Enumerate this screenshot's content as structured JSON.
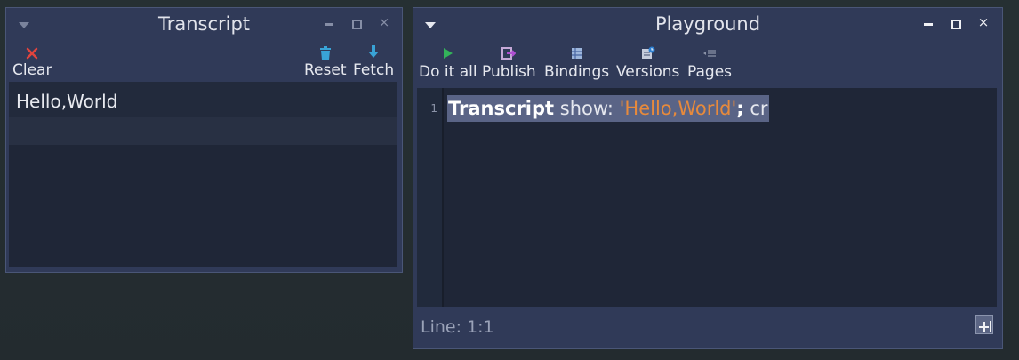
{
  "transcript": {
    "title": "Transcript",
    "toolbar": {
      "clear": "Clear",
      "reset": "Reset",
      "fetch": "Fetch"
    },
    "output": [
      "Hello,World"
    ],
    "icons": {
      "clear": "close-x-icon",
      "reset": "trash-icon",
      "fetch": "download-arrow-icon"
    },
    "colors": {
      "clear_icon": "#e0443e",
      "reset_icon": "#39a3d6",
      "fetch_icon": "#39a3d6"
    }
  },
  "playground": {
    "title": "Playground",
    "toolbar": {
      "do_it_all": "Do it all",
      "publish": "Publish",
      "bindings": "Bindings",
      "versions": "Versions",
      "pages": "Pages"
    },
    "icons": {
      "do_it_all": "play-icon",
      "publish": "publish-icon",
      "bindings": "bindings-icon",
      "versions": "versions-icon",
      "pages": "pages-icon"
    },
    "editor": {
      "line_number": "1",
      "code": {
        "receiver": "Transcript",
        "selector": " show: ",
        "string": "'Hello,World'",
        "semicolon": ";",
        "cascade": " cr"
      }
    },
    "status": "Line: 1:1",
    "colors": {
      "string_literal": "#e78a3c",
      "play_icon": "#33b35a"
    }
  }
}
